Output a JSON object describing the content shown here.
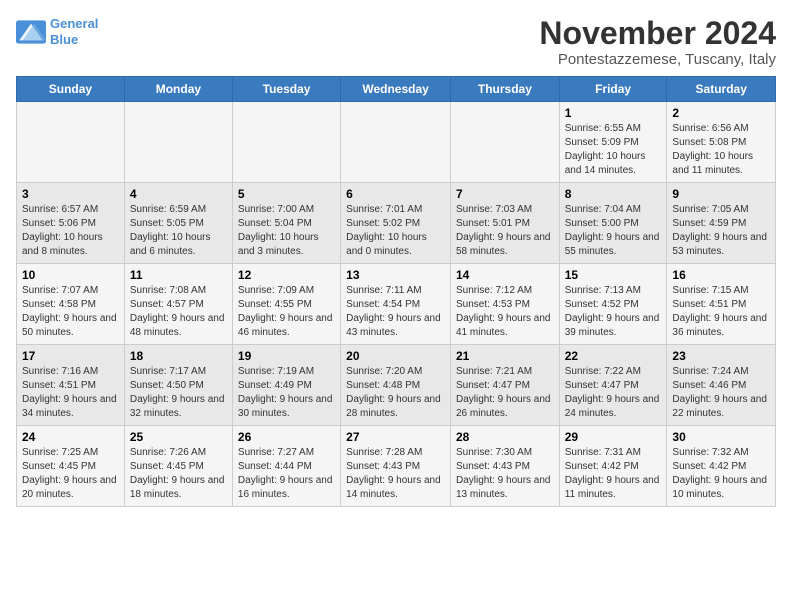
{
  "logo": {
    "line1": "General",
    "line2": "Blue"
  },
  "title": "November 2024",
  "subtitle": "Pontestazzemese, Tuscany, Italy",
  "weekdays": [
    "Sunday",
    "Monday",
    "Tuesday",
    "Wednesday",
    "Thursday",
    "Friday",
    "Saturday"
  ],
  "weeks": [
    [
      {
        "day": "",
        "info": ""
      },
      {
        "day": "",
        "info": ""
      },
      {
        "day": "",
        "info": ""
      },
      {
        "day": "",
        "info": ""
      },
      {
        "day": "",
        "info": ""
      },
      {
        "day": "1",
        "info": "Sunrise: 6:55 AM\nSunset: 5:09 PM\nDaylight: 10 hours and 14 minutes."
      },
      {
        "day": "2",
        "info": "Sunrise: 6:56 AM\nSunset: 5:08 PM\nDaylight: 10 hours and 11 minutes."
      }
    ],
    [
      {
        "day": "3",
        "info": "Sunrise: 6:57 AM\nSunset: 5:06 PM\nDaylight: 10 hours and 8 minutes."
      },
      {
        "day": "4",
        "info": "Sunrise: 6:59 AM\nSunset: 5:05 PM\nDaylight: 10 hours and 6 minutes."
      },
      {
        "day": "5",
        "info": "Sunrise: 7:00 AM\nSunset: 5:04 PM\nDaylight: 10 hours and 3 minutes."
      },
      {
        "day": "6",
        "info": "Sunrise: 7:01 AM\nSunset: 5:02 PM\nDaylight: 10 hours and 0 minutes."
      },
      {
        "day": "7",
        "info": "Sunrise: 7:03 AM\nSunset: 5:01 PM\nDaylight: 9 hours and 58 minutes."
      },
      {
        "day": "8",
        "info": "Sunrise: 7:04 AM\nSunset: 5:00 PM\nDaylight: 9 hours and 55 minutes."
      },
      {
        "day": "9",
        "info": "Sunrise: 7:05 AM\nSunset: 4:59 PM\nDaylight: 9 hours and 53 minutes."
      }
    ],
    [
      {
        "day": "10",
        "info": "Sunrise: 7:07 AM\nSunset: 4:58 PM\nDaylight: 9 hours and 50 minutes."
      },
      {
        "day": "11",
        "info": "Sunrise: 7:08 AM\nSunset: 4:57 PM\nDaylight: 9 hours and 48 minutes."
      },
      {
        "day": "12",
        "info": "Sunrise: 7:09 AM\nSunset: 4:55 PM\nDaylight: 9 hours and 46 minutes."
      },
      {
        "day": "13",
        "info": "Sunrise: 7:11 AM\nSunset: 4:54 PM\nDaylight: 9 hours and 43 minutes."
      },
      {
        "day": "14",
        "info": "Sunrise: 7:12 AM\nSunset: 4:53 PM\nDaylight: 9 hours and 41 minutes."
      },
      {
        "day": "15",
        "info": "Sunrise: 7:13 AM\nSunset: 4:52 PM\nDaylight: 9 hours and 39 minutes."
      },
      {
        "day": "16",
        "info": "Sunrise: 7:15 AM\nSunset: 4:51 PM\nDaylight: 9 hours and 36 minutes."
      }
    ],
    [
      {
        "day": "17",
        "info": "Sunrise: 7:16 AM\nSunset: 4:51 PM\nDaylight: 9 hours and 34 minutes."
      },
      {
        "day": "18",
        "info": "Sunrise: 7:17 AM\nSunset: 4:50 PM\nDaylight: 9 hours and 32 minutes."
      },
      {
        "day": "19",
        "info": "Sunrise: 7:19 AM\nSunset: 4:49 PM\nDaylight: 9 hours and 30 minutes."
      },
      {
        "day": "20",
        "info": "Sunrise: 7:20 AM\nSunset: 4:48 PM\nDaylight: 9 hours and 28 minutes."
      },
      {
        "day": "21",
        "info": "Sunrise: 7:21 AM\nSunset: 4:47 PM\nDaylight: 9 hours and 26 minutes."
      },
      {
        "day": "22",
        "info": "Sunrise: 7:22 AM\nSunset: 4:47 PM\nDaylight: 9 hours and 24 minutes."
      },
      {
        "day": "23",
        "info": "Sunrise: 7:24 AM\nSunset: 4:46 PM\nDaylight: 9 hours and 22 minutes."
      }
    ],
    [
      {
        "day": "24",
        "info": "Sunrise: 7:25 AM\nSunset: 4:45 PM\nDaylight: 9 hours and 20 minutes."
      },
      {
        "day": "25",
        "info": "Sunrise: 7:26 AM\nSunset: 4:45 PM\nDaylight: 9 hours and 18 minutes."
      },
      {
        "day": "26",
        "info": "Sunrise: 7:27 AM\nSunset: 4:44 PM\nDaylight: 9 hours and 16 minutes."
      },
      {
        "day": "27",
        "info": "Sunrise: 7:28 AM\nSunset: 4:43 PM\nDaylight: 9 hours and 14 minutes."
      },
      {
        "day": "28",
        "info": "Sunrise: 7:30 AM\nSunset: 4:43 PM\nDaylight: 9 hours and 13 minutes."
      },
      {
        "day": "29",
        "info": "Sunrise: 7:31 AM\nSunset: 4:42 PM\nDaylight: 9 hours and 11 minutes."
      },
      {
        "day": "30",
        "info": "Sunrise: 7:32 AM\nSunset: 4:42 PM\nDaylight: 9 hours and 10 minutes."
      }
    ]
  ]
}
